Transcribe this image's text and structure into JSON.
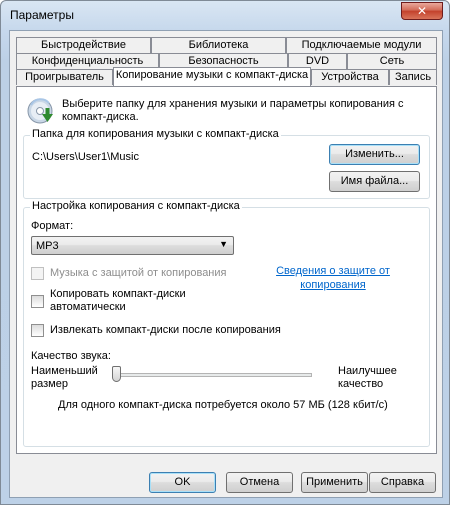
{
  "window": {
    "title": "Параметры",
    "close_symbol": "✕"
  },
  "tabs": {
    "row1": [
      "Быстродействие",
      "Библиотека",
      "Подключаемые модули"
    ],
    "row2": [
      "Конфиденциальность",
      "Безопасность",
      "DVD",
      "Сеть"
    ],
    "row3": [
      "Проигрыватель",
      "Копирование музыки с компакт-диска",
      "Устройства",
      "Запись"
    ],
    "active": "Копирование музыки с компакт-диска"
  },
  "intro": {
    "icon": "cd-rip-icon",
    "text": "Выберите папку для хранения музыки и параметры копирования с компакт-диска."
  },
  "folder_group": {
    "caption": "Папка для копирования музыки с компакт-диска",
    "path": "C:\\Users\\User1\\Music",
    "change_button": "Изменить...",
    "filename_button": "Имя файла..."
  },
  "rip_group": {
    "caption": "Настройка копирования с компакт-диска",
    "format_label": "Формат:",
    "format_value": "MP3",
    "copy_protect_label": "Музыка с защитой от копирования",
    "copy_protect_checked": false,
    "copy_protect_enabled": false,
    "protection_link": "Сведения о защите от копирования",
    "auto_rip_label": "Копировать компакт-диски автоматически",
    "auto_rip_checked": false,
    "eject_label": "Извлекать компакт-диски после копирования",
    "eject_checked": false,
    "quality_label": "Качество звука:",
    "quality_min": "Наименьший размер",
    "quality_max": "Наилучшее качество",
    "quality_level": 0,
    "quality_info": "Для одного компакт-диска потребуется около  57 МБ (128 кбит/с)"
  },
  "buttons": {
    "ok": "OK",
    "cancel": "Отмена",
    "apply": "Применить",
    "help": "Справка"
  }
}
